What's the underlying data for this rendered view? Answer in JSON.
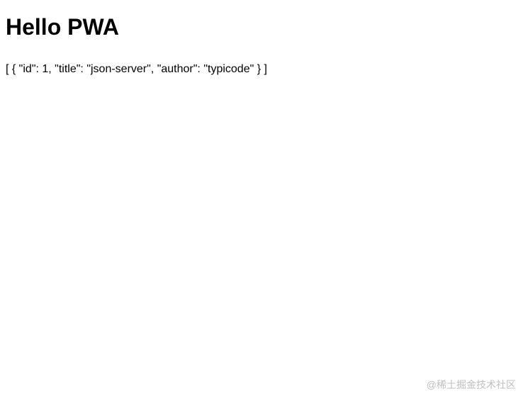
{
  "heading": "Hello PWA",
  "json_output": "[ { \"id\": 1, \"title\": \"json-server\", \"author\": \"typicode\" } ]",
  "watermark": "@稀土掘金技术社区"
}
